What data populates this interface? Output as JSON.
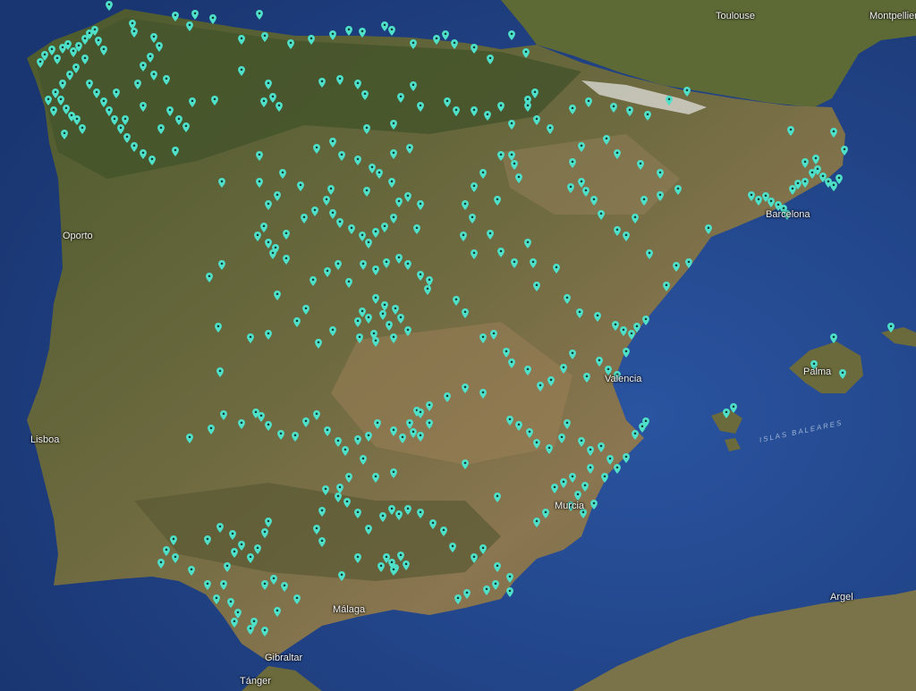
{
  "map": {
    "type": "satellite",
    "colors": {
      "sea": "#24478c",
      "sea_deep": "#173366",
      "land": "#5c6138",
      "land_dry": "#8a7550",
      "forest": "#3f4d28",
      "snow": "#d8d8d2",
      "marker": "#4fe0c9",
      "marker_dot": "#0e3b34"
    },
    "labels": {
      "toulouse": "Toulouse",
      "montpellier": "Montpellier",
      "oporto": "Oporto",
      "lisboa": "Lisboa",
      "barcelona": "Barcelona",
      "valencia": "Valencia",
      "murcia": "Murcia",
      "malaga": "Málaga",
      "gibraltar": "Gibraltar",
      "tanger": "Tánger",
      "argel": "Argel",
      "palma": "Palma",
      "baleares": "ISLAS BALEARES"
    }
  }
}
